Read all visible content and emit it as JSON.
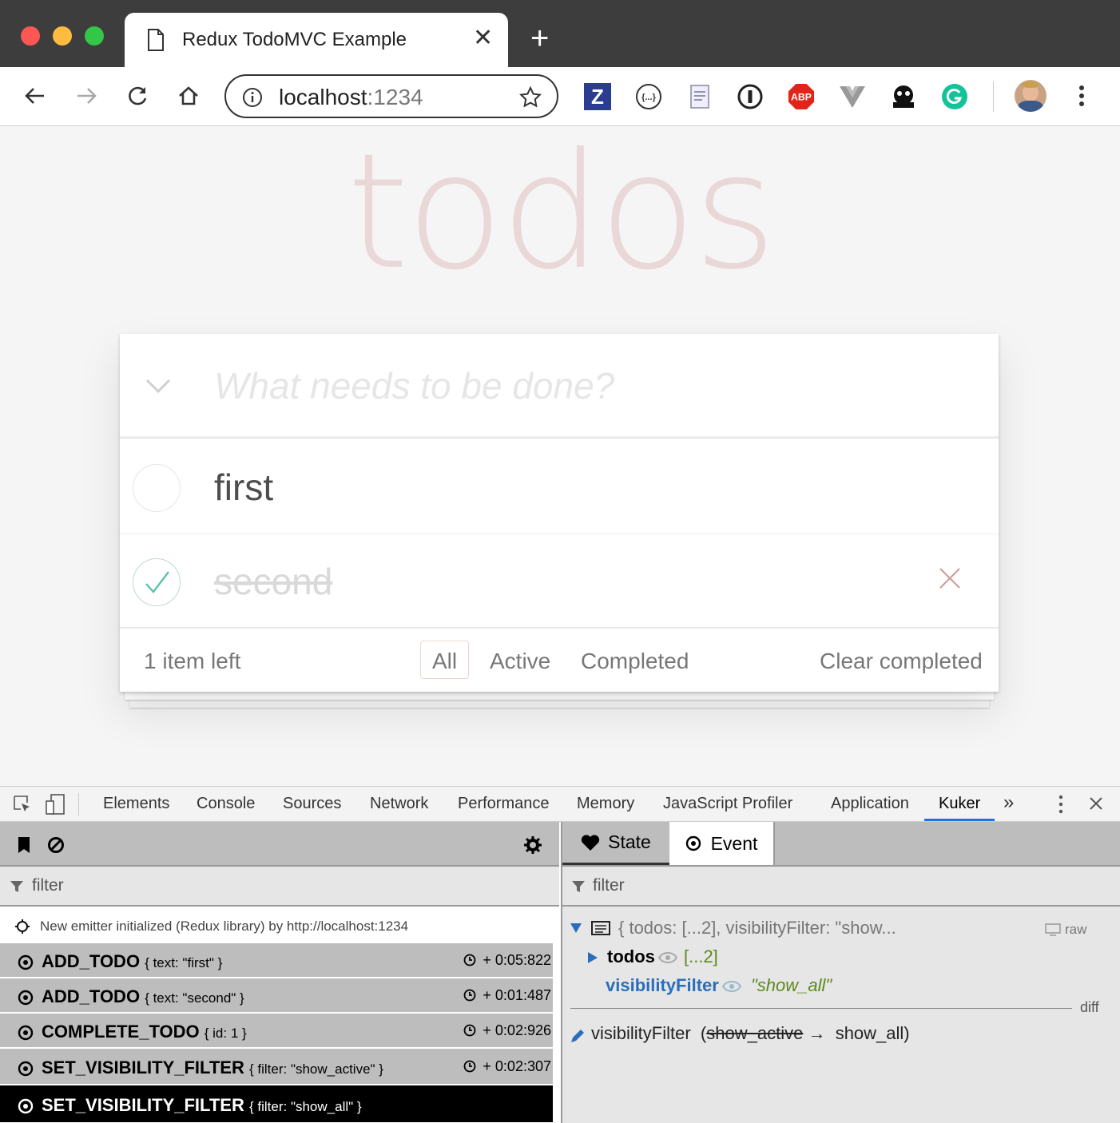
{
  "browser": {
    "tab_title": "Redux TodoMVC Example",
    "url_host": "localhost",
    "url_port": ":1234",
    "extensions": [
      "zotero-icon",
      "json-viewer-icon",
      "save-page-icon",
      "onepassword-icon",
      "adblock-plus-icon",
      "vue-devtools-icon",
      "kuker-icon",
      "grammarly-icon"
    ],
    "abp_label": "ABP",
    "zotero_label": "Z"
  },
  "app": {
    "title": "todos",
    "new_todo_placeholder": "What needs to be done?",
    "todos": [
      {
        "text": "first",
        "completed": false
      },
      {
        "text": "second",
        "completed": true
      }
    ],
    "footer": {
      "count": "1 item left",
      "filters": [
        "All",
        "Active",
        "Completed"
      ],
      "selected_filter": "All",
      "clear": "Clear completed"
    }
  },
  "devtools": {
    "tabs": [
      "Elements",
      "Console",
      "Sources",
      "Network",
      "Performance",
      "Memory",
      "JavaScript Profiler",
      "Application",
      "Kuker"
    ],
    "active_tab": "Kuker",
    "more": "»",
    "left": {
      "filter_placeholder": "filter",
      "info": "New emitter initialized (Redux library) by http://localhost:1234",
      "events": [
        {
          "name": "ADD_TODO",
          "payload": "{ text: \"first\" }",
          "time": "+ 0:05:822"
        },
        {
          "name": "ADD_TODO",
          "payload": "{ text: \"second\" }",
          "time": "+ 0:01:487"
        },
        {
          "name": "COMPLETE_TODO",
          "payload": "{ id: 1 }",
          "time": "+ 0:02:926"
        },
        {
          "name": "SET_VISIBILITY_FILTER",
          "payload": "{ filter: \"show_active\" }",
          "time": "+ 0:02:307"
        },
        {
          "name": "SET_VISIBILITY_FILTER",
          "payload": "{ filter: \"show_all\" }",
          "time": ""
        }
      ]
    },
    "right": {
      "tab_state": "State",
      "tab_event": "Event",
      "filter_placeholder": "filter",
      "root_summary": "{ todos: [...2], visibilityFilter: \"show...",
      "raw": "raw",
      "todos_key": "todos",
      "todos_value": "[...2]",
      "vf_key": "visibilityFilter",
      "vf_value": "\"show_all\"",
      "diff_label": "diff",
      "diff_key": "visibilityFilter",
      "diff_old": "show_active",
      "diff_new": "show_all)",
      "diff_open": "(",
      "diff_arrow": "→"
    }
  },
  "colors": {
    "title": "#e8d4d4",
    "check": "#5dc2af",
    "destroy": "#cc9a9a",
    "json_key": "#2a6ebb",
    "json_string": "#5b8a1b",
    "devtools_accent": "#1a73e8"
  }
}
